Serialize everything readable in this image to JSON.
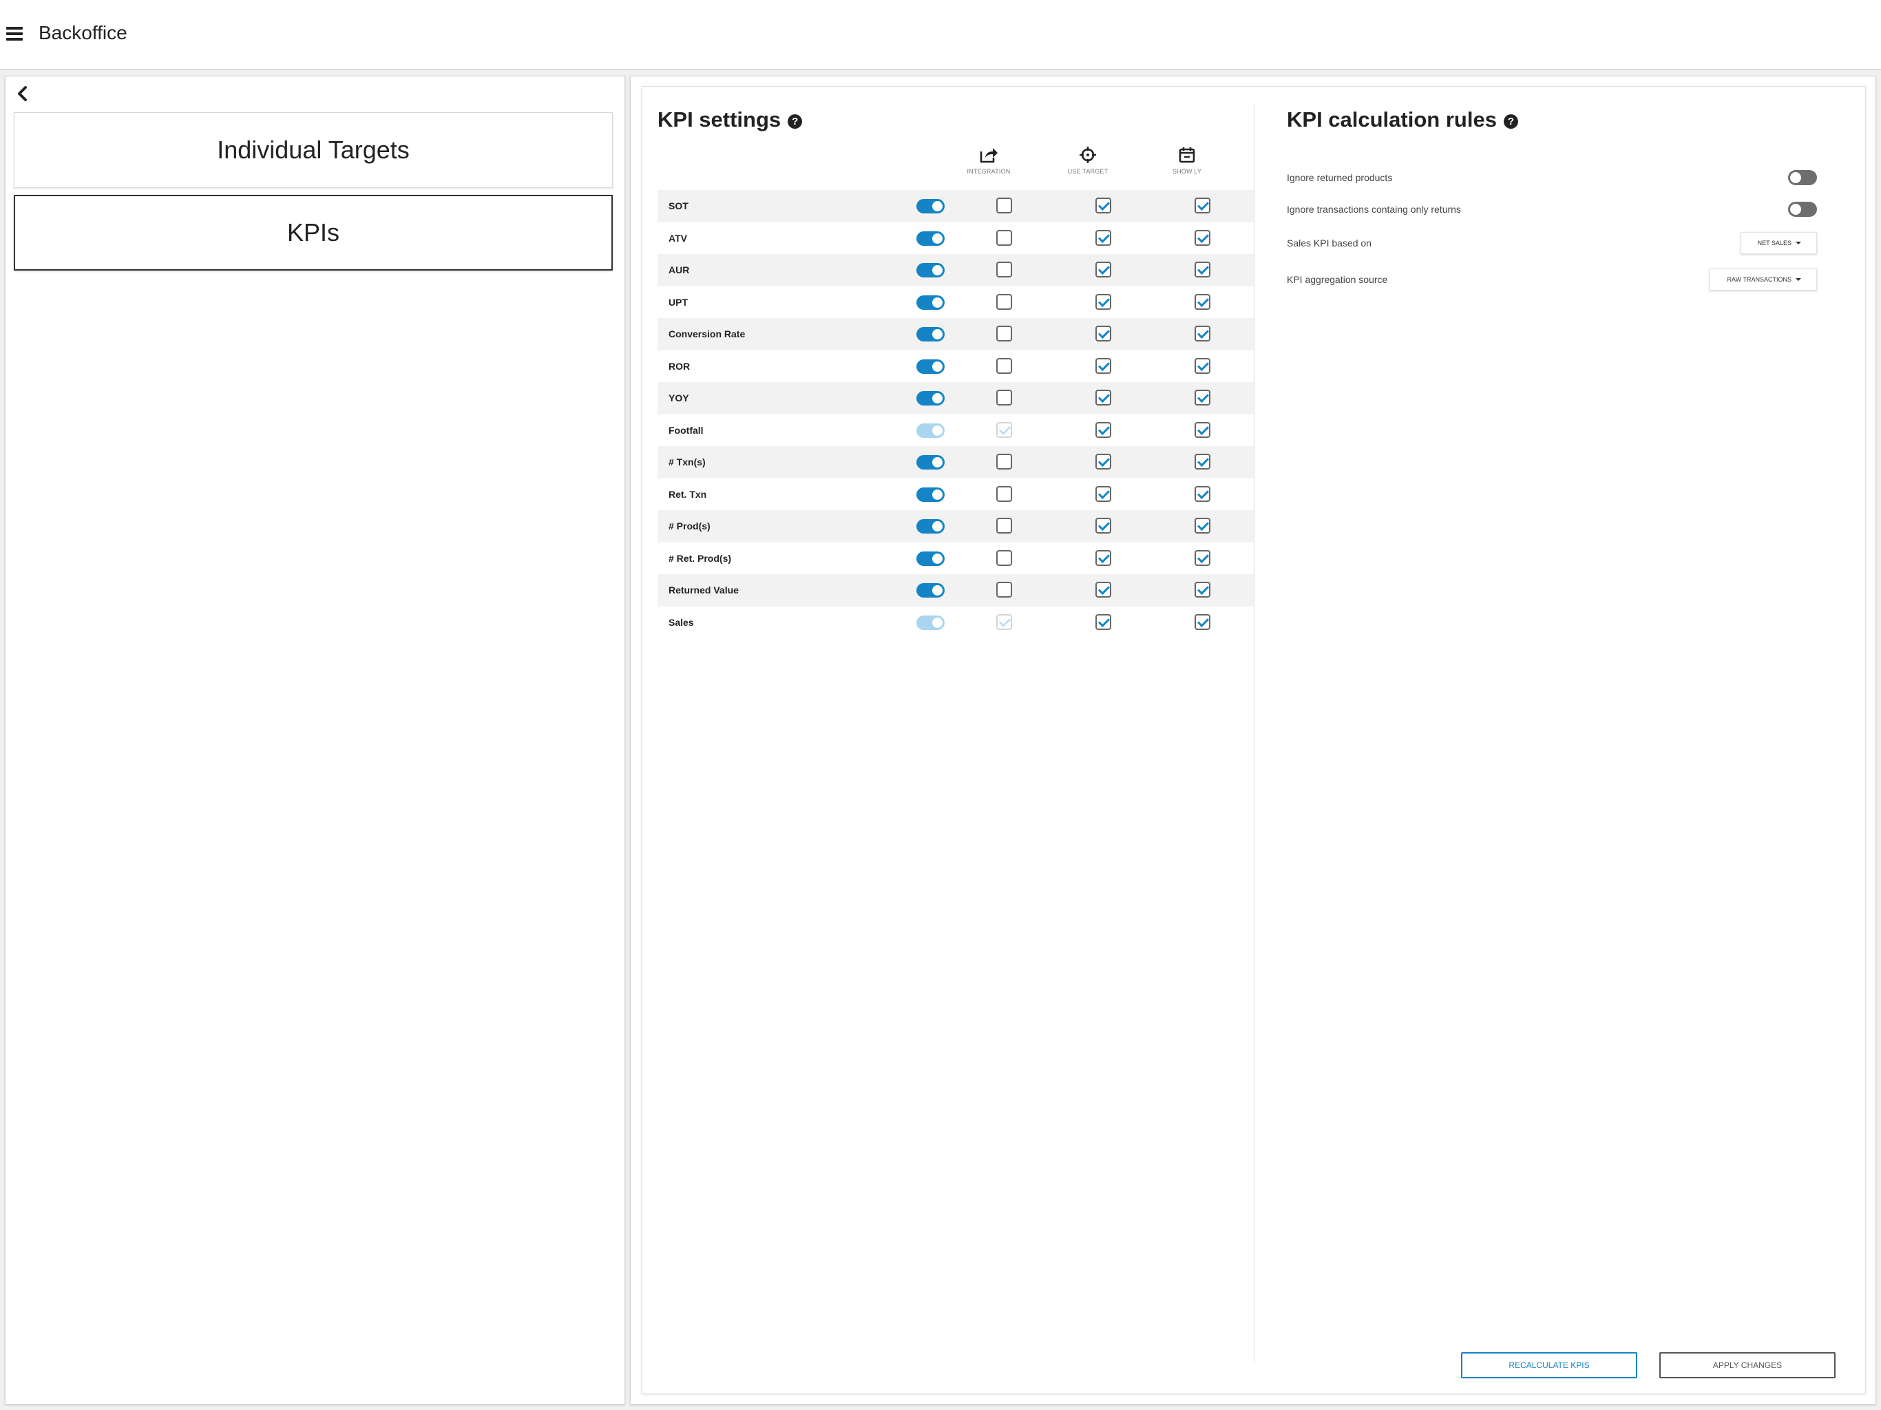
{
  "header": {
    "title": "Backoffice"
  },
  "sidebar": {
    "items": [
      {
        "label": "Individual Targets",
        "active": false
      },
      {
        "label": "KPIs",
        "active": true
      }
    ]
  },
  "kpi_settings": {
    "title": "KPI settings",
    "columns": {
      "integration": "INTEGRATION",
      "use_target": "USE TARGET",
      "show_ly": "SHOW LY"
    },
    "rows": [
      {
        "name": "SOT",
        "enabled": true,
        "enabled_disabled": false,
        "integration": false,
        "integration_disabled": false,
        "use_target": true,
        "show_ly": true
      },
      {
        "name": "ATV",
        "enabled": true,
        "enabled_disabled": false,
        "integration": false,
        "integration_disabled": false,
        "use_target": true,
        "show_ly": true
      },
      {
        "name": "AUR",
        "enabled": true,
        "enabled_disabled": false,
        "integration": false,
        "integration_disabled": false,
        "use_target": true,
        "show_ly": true
      },
      {
        "name": "UPT",
        "enabled": true,
        "enabled_disabled": false,
        "integration": false,
        "integration_disabled": false,
        "use_target": true,
        "show_ly": true
      },
      {
        "name": "Conversion Rate",
        "enabled": true,
        "enabled_disabled": false,
        "integration": false,
        "integration_disabled": false,
        "use_target": true,
        "show_ly": true
      },
      {
        "name": "ROR",
        "enabled": true,
        "enabled_disabled": false,
        "integration": false,
        "integration_disabled": false,
        "use_target": true,
        "show_ly": true
      },
      {
        "name": "YOY",
        "enabled": true,
        "enabled_disabled": false,
        "integration": false,
        "integration_disabled": false,
        "use_target": true,
        "show_ly": true
      },
      {
        "name": "Footfall",
        "enabled": true,
        "enabled_disabled": true,
        "integration": true,
        "integration_disabled": true,
        "use_target": true,
        "show_ly": true
      },
      {
        "name": "# Txn(s)",
        "enabled": true,
        "enabled_disabled": false,
        "integration": false,
        "integration_disabled": false,
        "use_target": true,
        "show_ly": true
      },
      {
        "name": "Ret. Txn",
        "enabled": true,
        "enabled_disabled": false,
        "integration": false,
        "integration_disabled": false,
        "use_target": true,
        "show_ly": true
      },
      {
        "name": "# Prod(s)",
        "enabled": true,
        "enabled_disabled": false,
        "integration": false,
        "integration_disabled": false,
        "use_target": true,
        "show_ly": true
      },
      {
        "name": "# Ret. Prod(s)",
        "enabled": true,
        "enabled_disabled": false,
        "integration": false,
        "integration_disabled": false,
        "use_target": true,
        "show_ly": true
      },
      {
        "name": "Returned Value",
        "enabled": true,
        "enabled_disabled": false,
        "integration": false,
        "integration_disabled": false,
        "use_target": true,
        "show_ly": true
      },
      {
        "name": "Sales",
        "enabled": true,
        "enabled_disabled": true,
        "integration": true,
        "integration_disabled": true,
        "use_target": true,
        "show_ly": true
      }
    ]
  },
  "kpi_rules": {
    "title": "KPI calculation rules",
    "ignore_returned_products": {
      "label": "Ignore returned products",
      "value": false
    },
    "ignore_return_only_transactions": {
      "label": "Ignore transactions containg only returns",
      "value": false
    },
    "sales_kpi_based_on": {
      "label": "Sales KPI based on",
      "selected": "NET SALES"
    },
    "kpi_aggregation_source": {
      "label": "KPI aggregation source",
      "selected": "RAW TRANSACTIONS"
    }
  },
  "actions": {
    "recalculate_label": "RECALCULATE KPIS",
    "apply_label": "APPLY CHANGES"
  },
  "colors": {
    "accent": "#1484c6",
    "accent_disabled": "#a9d5ee",
    "toggle_off": "#6e6e6e"
  }
}
